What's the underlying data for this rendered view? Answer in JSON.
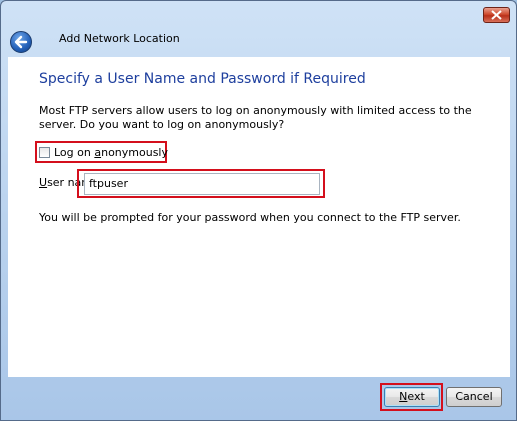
{
  "window": {
    "close_icon": "close-icon"
  },
  "header": {
    "back_icon": "back-arrow-icon",
    "title": "Add Network Location"
  },
  "page": {
    "heading": "Specify a User Name and Password if Required",
    "description": "Most FTP servers allow users to log on anonymously with limited access to the server.  Do you want to log on anonymously?",
    "anonymous_checkbox": {
      "label_pre": "Log on ",
      "label_access": "a",
      "label_post": "nonymously",
      "checked": false
    },
    "username": {
      "label_access": "U",
      "label_post": "ser name:",
      "value": "ftpuser"
    },
    "prompt": "You will be prompted for your password when you connect to the FTP server."
  },
  "footer": {
    "next_access": "N",
    "next_post": "ext",
    "cancel_label": "Cancel"
  },
  "colors": {
    "heading": "#1e3f9e",
    "highlight": "#d40f1c",
    "content_bg": "#ffffff"
  }
}
